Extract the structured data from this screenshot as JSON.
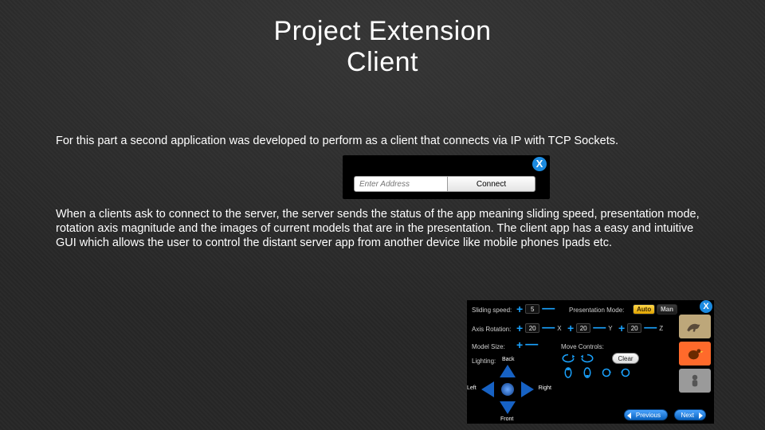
{
  "title_line1": "Project Extension",
  "title_line2": "Client",
  "para1": "For this part a second application was developed to perform as a client that connects via IP with TCP Sockets.",
  "para2": "When a clients ask to connect to the server, the server sends the status of the app meaning sliding speed, presentation mode, rotation axis magnitude and the images of current models that are in the presentation. The client app has a easy and intuitive GUI which allows the user to control the distant server app from another device like mobile phones Ipads etc.",
  "connect": {
    "placeholder": "Enter Address",
    "button": "Connect",
    "close": "X"
  },
  "gui": {
    "close": "X",
    "sliding_speed_label": "Sliding speed:",
    "sliding_speed_value": "5",
    "presentation_mode_label": "Presentation Mode:",
    "mode_auto": "Auto",
    "mode_man": "Man",
    "axis_rotation_label": "Axis Rotation:",
    "axis_x": "20",
    "axis_y": "20",
    "axis_z": "20",
    "axis_x_lbl": "X",
    "axis_y_lbl": "Y",
    "axis_z_lbl": "Z",
    "model_size_label": "Model Size:",
    "move_controls_label": "Move Controls:",
    "clear": "Clear",
    "lighting_label": "Lighting:",
    "dir_back": "Back",
    "dir_front": "Front",
    "dir_left": "Left",
    "dir_right": "Right",
    "prev": "Previous",
    "next": "Next"
  }
}
